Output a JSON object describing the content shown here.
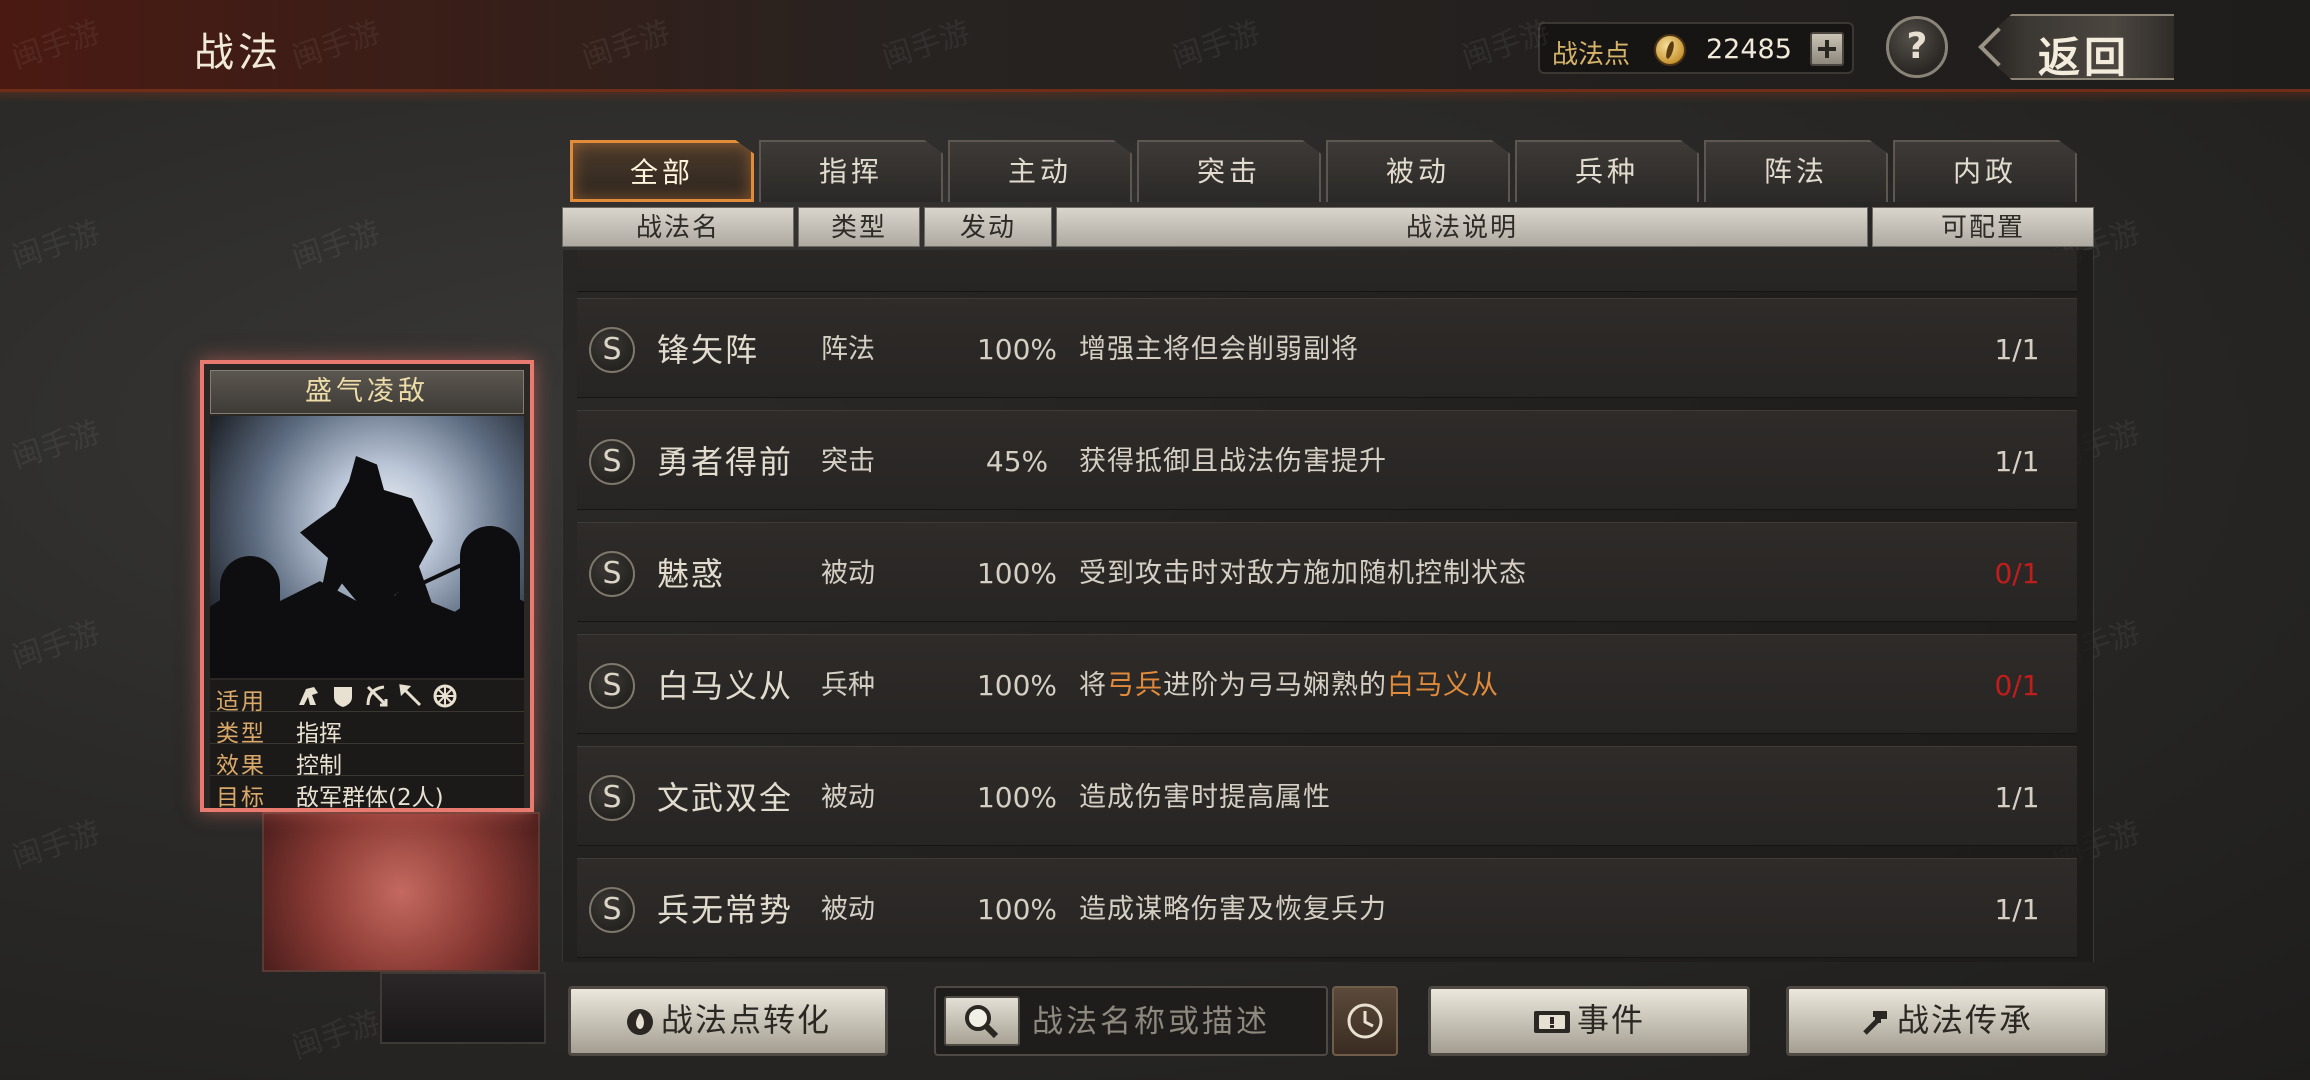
{
  "header": {
    "title": "战法",
    "points_label": "战法点",
    "points_value": "22485",
    "help_label": "?",
    "back_label": "返回"
  },
  "watermark": "闽手游",
  "tabs": [
    {
      "label": "全部",
      "active": true
    },
    {
      "label": "指挥"
    },
    {
      "label": "主动"
    },
    {
      "label": "突击"
    },
    {
      "label": "被动"
    },
    {
      "label": "兵种"
    },
    {
      "label": "阵法"
    },
    {
      "label": "内政"
    }
  ],
  "columns": [
    "战法名",
    "类型",
    "发动",
    "战法说明",
    "可配置"
  ],
  "rows": [
    {
      "grade": "S",
      "name": "锋矢阵",
      "type": "阵法",
      "rate": "100%",
      "desc": "增强主将但会削弱副将",
      "config": "1/1",
      "config_red": false
    },
    {
      "grade": "S",
      "name": "勇者得前",
      "type": "突击",
      "rate": "45%",
      "desc": "获得抵御且战法伤害提升",
      "config": "1/1",
      "config_red": false
    },
    {
      "grade": "S",
      "name": "魅惑",
      "type": "被动",
      "rate": "100%",
      "desc": "受到攻击时对敌方施加随机控制状态",
      "config": "0/1",
      "config_red": true
    },
    {
      "grade": "S",
      "name": "白马义从",
      "type": "兵种",
      "rate": "100%",
      "desc_parts": [
        "将",
        "弓兵",
        "进阶为弓马娴熟的",
        "白马义从"
      ],
      "config": "0/1",
      "config_red": true
    },
    {
      "grade": "S",
      "name": "文武双全",
      "type": "被动",
      "rate": "100%",
      "desc": "造成伤害时提高属性",
      "config": "1/1",
      "config_red": false
    },
    {
      "grade": "S",
      "name": "兵无常势",
      "type": "被动",
      "rate": "100%",
      "desc": "造成谋略伤害及恢复兵力",
      "config": "1/1",
      "config_red": false
    }
  ],
  "card": {
    "title": "盛气凌敌",
    "apply_label": "适用",
    "type_label": "类型",
    "type_value": "指挥",
    "effect_label": "效果",
    "effect_value": "控制",
    "target_label": "目标",
    "target_value": "敌军群体(2人)",
    "unit_icons": [
      "cavalry-icon",
      "shield-icon",
      "bow-icon",
      "spear-icon",
      "wheel-icon"
    ]
  },
  "bottom": {
    "convert_label": "战法点转化",
    "search_placeholder": "战法名称或描述",
    "events_label": "事件",
    "inherit_label": "战法传承"
  },
  "colors": {
    "accent_orange": "#e08a3a",
    "config_red": "#c21d1d",
    "card_border": "#e87a70"
  }
}
